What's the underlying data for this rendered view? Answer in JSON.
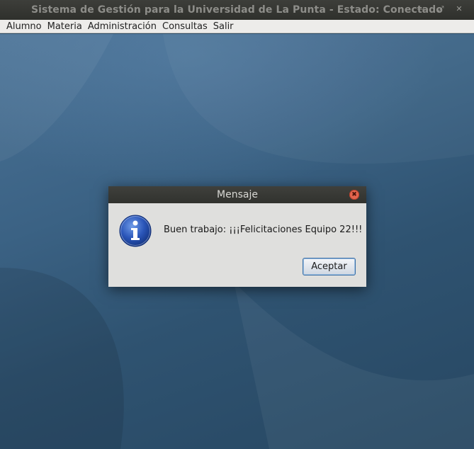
{
  "window": {
    "title": "Sistema de Gestión para la Universidad de La Punta - Estado: Conectado",
    "controls": {
      "minimize": "—",
      "maximize": "⤢",
      "close": "✕"
    }
  },
  "menubar": {
    "items": [
      "Alumno",
      "Materia",
      "Administración",
      "Consultas",
      "Salir"
    ]
  },
  "dialog": {
    "title": "Mensaje",
    "icon": "info-icon",
    "message": "Buen trabajo: ¡¡¡Felicitaciones Equipo 22!!!",
    "ok_label": "Aceptar",
    "close_glyph": "✖"
  },
  "colors": {
    "titlebar": "#31322e",
    "desktop": "#3b6284",
    "dialog_body": "#dfdfdd",
    "close_button": "#e2654e",
    "info_icon": "#2a55b8"
  }
}
